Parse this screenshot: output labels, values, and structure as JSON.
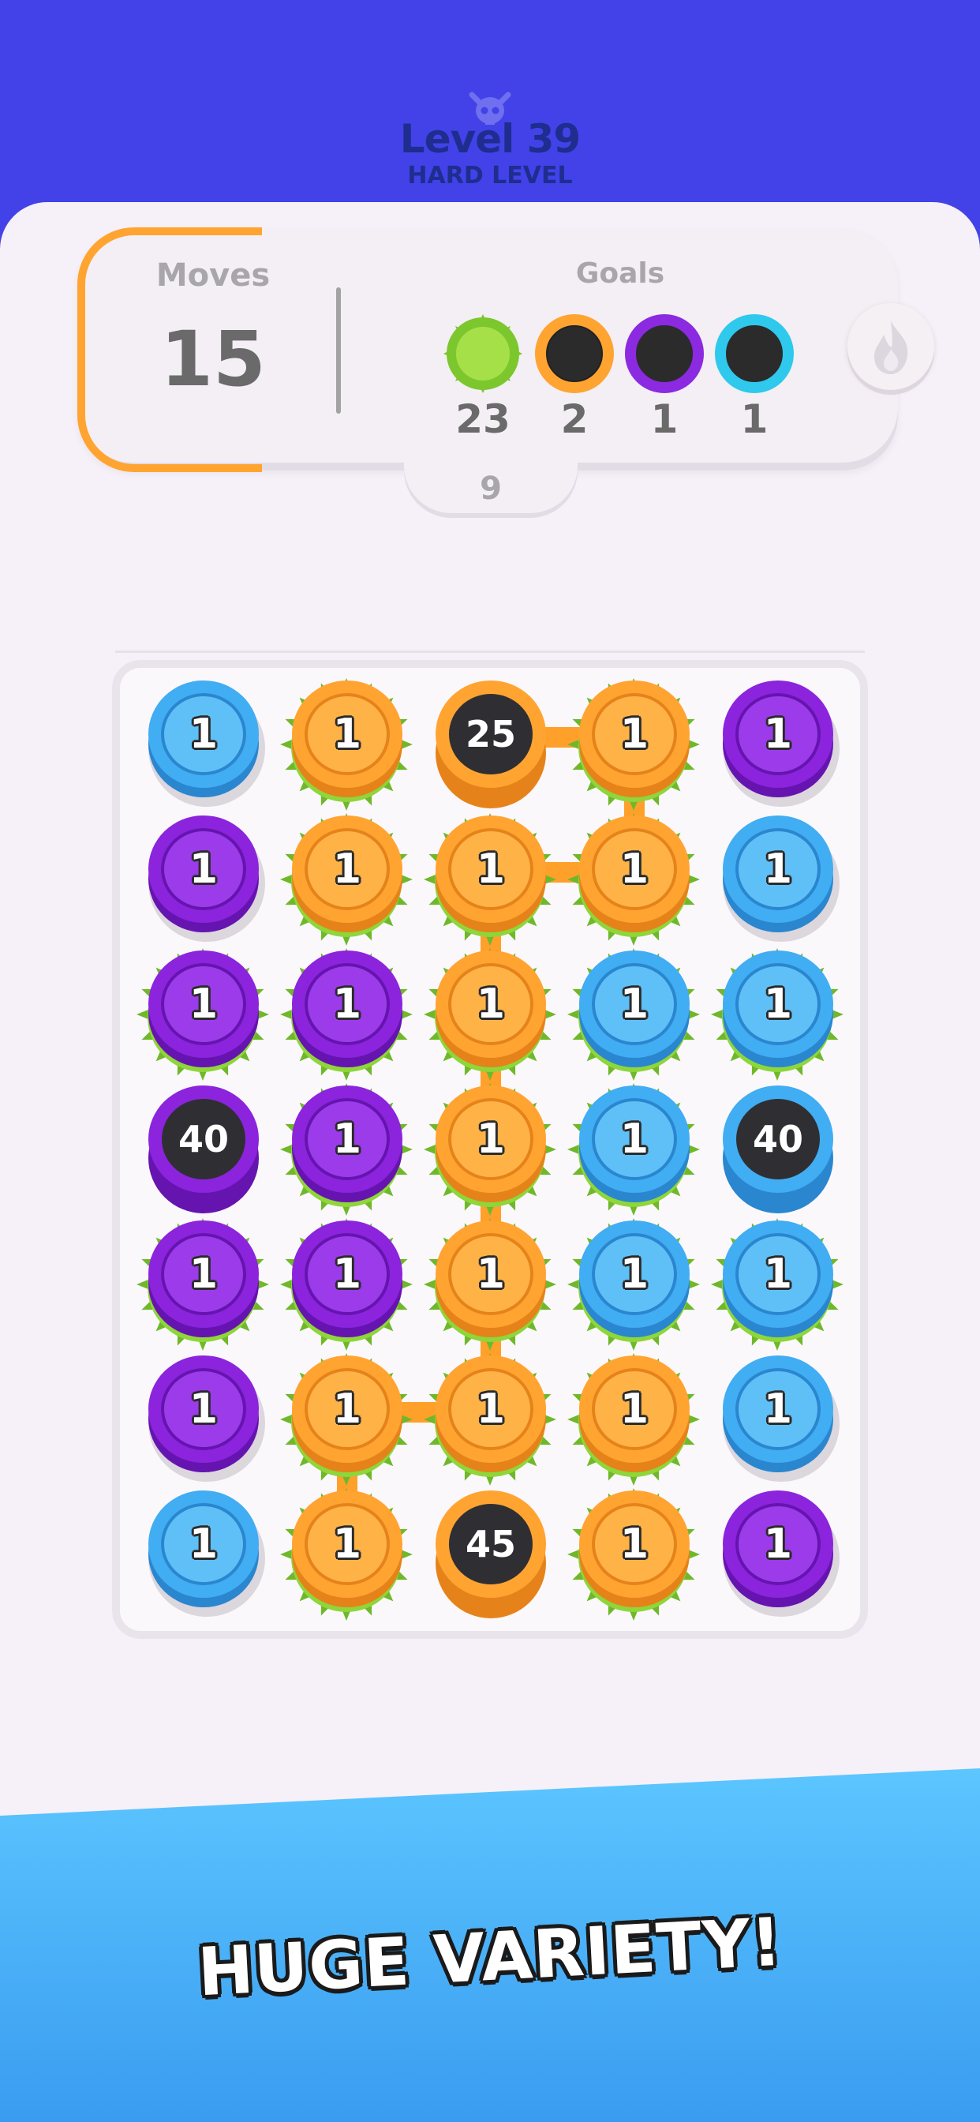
{
  "header": {
    "level_title": "Level 39",
    "level_subtitle": "HARD LEVEL",
    "icon": "skull-icon"
  },
  "stats": {
    "moves_label": "Moves",
    "moves_value": "15",
    "goals_label": "Goals",
    "goals": [
      {
        "type": "moss",
        "count": "23",
        "color": "#8ed63a"
      },
      {
        "type": "orange-hole",
        "count": "2",
        "color": "#ffa431"
      },
      {
        "type": "purple-hole",
        "count": "1",
        "color": "#8b2ae0"
      },
      {
        "type": "blue-hole",
        "count": "1",
        "color": "#2ec9ec"
      }
    ],
    "tab_value": "9",
    "fire_icon": "fire-icon"
  },
  "colors": {
    "orange": "#ffa431",
    "blue": "#3aa8ef",
    "purple": "#8b24dc",
    "moss": "#8ed63a",
    "header": "#4242e8"
  },
  "board": {
    "rows": [
      [
        {
          "c": "blue",
          "v": "1",
          "m": false
        },
        {
          "c": "orange",
          "v": "1",
          "m": true
        },
        {
          "c": "orange",
          "v": "25",
          "m": false,
          "hole": true
        },
        {
          "c": "orange",
          "v": "1",
          "m": true
        },
        {
          "c": "purple",
          "v": "1",
          "m": false
        }
      ],
      [
        {
          "c": "purple",
          "v": "1",
          "m": false
        },
        {
          "c": "orange",
          "v": "1",
          "m": true
        },
        {
          "c": "orange",
          "v": "1",
          "m": true
        },
        {
          "c": "orange",
          "v": "1",
          "m": true
        },
        {
          "c": "blue",
          "v": "1",
          "m": false
        }
      ],
      [
        {
          "c": "purple",
          "v": "1",
          "m": true
        },
        {
          "c": "purple",
          "v": "1",
          "m": true
        },
        {
          "c": "orange",
          "v": "1",
          "m": true
        },
        {
          "c": "blue",
          "v": "1",
          "m": true
        },
        {
          "c": "blue",
          "v": "1",
          "m": true
        }
      ],
      [
        {
          "c": "purple",
          "v": "40",
          "m": false,
          "hole": true
        },
        {
          "c": "purple",
          "v": "1",
          "m": true
        },
        {
          "c": "orange",
          "v": "1",
          "m": true
        },
        {
          "c": "blue",
          "v": "1",
          "m": true
        },
        {
          "c": "blue",
          "v": "40",
          "m": false,
          "hole": true
        }
      ],
      [
        {
          "c": "purple",
          "v": "1",
          "m": true
        },
        {
          "c": "purple",
          "v": "1",
          "m": true
        },
        {
          "c": "orange",
          "v": "1",
          "m": true
        },
        {
          "c": "blue",
          "v": "1",
          "m": true
        },
        {
          "c": "blue",
          "v": "1",
          "m": true
        }
      ],
      [
        {
          "c": "purple",
          "v": "1",
          "m": false
        },
        {
          "c": "orange",
          "v": "1",
          "m": true
        },
        {
          "c": "orange",
          "v": "1",
          "m": true
        },
        {
          "c": "orange",
          "v": "1",
          "m": true
        },
        {
          "c": "blue",
          "v": "1",
          "m": false
        }
      ],
      [
        {
          "c": "blue",
          "v": "1",
          "m": false
        },
        {
          "c": "orange",
          "v": "1",
          "m": true
        },
        {
          "c": "orange",
          "v": "45",
          "m": false,
          "hole": true
        },
        {
          "c": "orange",
          "v": "1",
          "m": true
        },
        {
          "c": "purple",
          "v": "1",
          "m": false
        }
      ]
    ],
    "links": [
      {
        "from": [
          0,
          2
        ],
        "to": [
          0,
          3
        ]
      },
      {
        "from": [
          0,
          3
        ],
        "to": [
          1,
          3
        ]
      },
      {
        "from": [
          1,
          3
        ],
        "to": [
          1,
          2
        ]
      },
      {
        "from": [
          1,
          2
        ],
        "to": [
          2,
          2
        ]
      },
      {
        "from": [
          2,
          2
        ],
        "to": [
          3,
          2
        ]
      },
      {
        "from": [
          3,
          2
        ],
        "to": [
          4,
          2
        ]
      },
      {
        "from": [
          4,
          2
        ],
        "to": [
          5,
          2
        ]
      },
      {
        "from": [
          5,
          2
        ],
        "to": [
          5,
          1
        ]
      },
      {
        "from": [
          5,
          1
        ],
        "to": [
          6,
          1
        ]
      }
    ]
  },
  "footer": {
    "banner": "HUGE VARIETY!"
  }
}
